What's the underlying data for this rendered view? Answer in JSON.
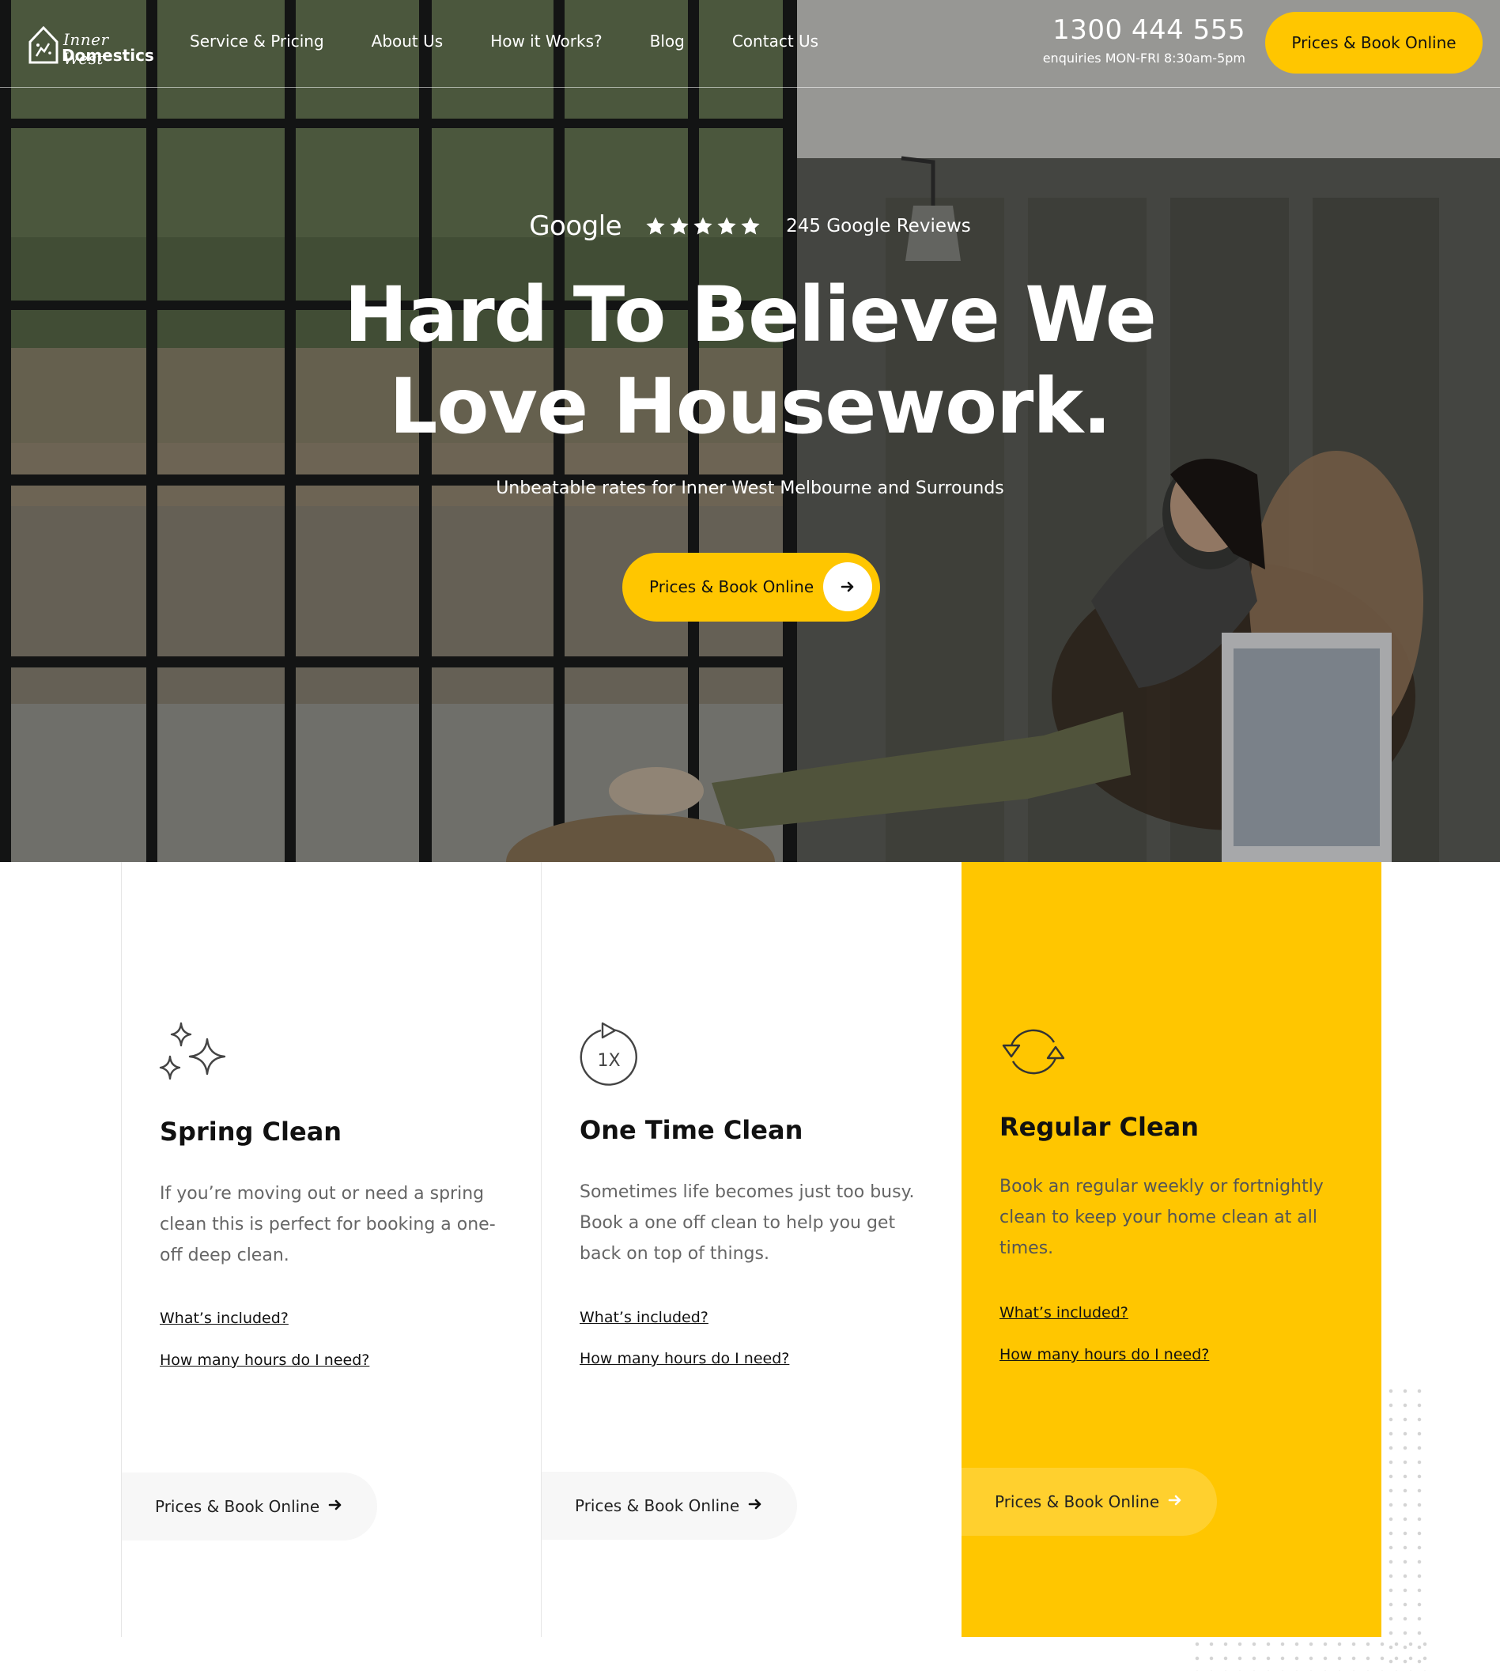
{
  "brand": {
    "line1": "Inner West",
    "line2": "Domestics"
  },
  "nav": {
    "items": [
      "Service & Pricing",
      "About Us",
      "How it Works?",
      "Blog",
      "Contact Us"
    ]
  },
  "contact": {
    "phone": "1300 444 555",
    "hours": "enquiries MON-FRI 8:30am-5pm"
  },
  "header": {
    "book_label": "Prices & Book Online"
  },
  "hero": {
    "google_word": "Google",
    "rating_stars": 5,
    "reviews_text": "245 Google Reviews",
    "headline_line1": "Hard To Believe We",
    "headline_line2": "Love Housework.",
    "subline": "Unbeatable rates for Inner West Melbourne and Surrounds",
    "cta_label": "Prices & Book Online"
  },
  "services": [
    {
      "title": "Spring Clean",
      "description": "If you’re moving out or need a spring clean this is perfect for booking a one-off deep clean.",
      "link1": "What’s included?",
      "link2": "How many hours do I need?",
      "cta": "Prices & Book Online"
    },
    {
      "title": "One Time Clean",
      "icon_text": "1X",
      "description": "Sometimes life becomes just too busy. Book a one off clean to help you get back on top of things.",
      "link1": "What’s included?",
      "link2": "How many hours do I need?",
      "cta": "Prices & Book Online"
    },
    {
      "title": "Regular Clean",
      "description": "Book an regular weekly or fortnightly clean to keep your home clean at all times.",
      "link1": "What’s included?",
      "link2": "How many hours do I need?",
      "cta": "Prices & Book Online"
    }
  ],
  "colors": {
    "accent": "#ffc600",
    "text": "#111111",
    "muted": "#666666"
  }
}
